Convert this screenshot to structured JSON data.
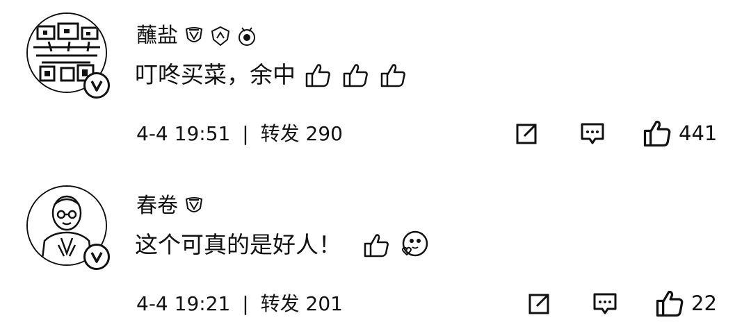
{
  "comments": [
    {
      "username": "蘸盐",
      "text": "叮咚买菜，余中",
      "badges": [
        "shield-crest-icon",
        "shield-badge-icon",
        "medal-icon"
      ],
      "emojis": [
        "thumbs-up-emoji",
        "thumbs-up-emoji",
        "thumbs-up-emoji"
      ],
      "time": "4-4 19:51",
      "separator": "|",
      "repost_label": "转发",
      "repost_count": "290",
      "like_count": "441",
      "verified": true
    },
    {
      "username": "春卷",
      "text": "这个可真的是好人！",
      "badges": [
        "shield-crest-icon"
      ],
      "emojis": [
        "thumbs-up-emoji",
        "heart-face-emoji"
      ],
      "time": "4-4 19:21",
      "separator": "|",
      "repost_label": "转发",
      "repost_count": "201",
      "like_count": "22",
      "verified": true
    }
  ]
}
